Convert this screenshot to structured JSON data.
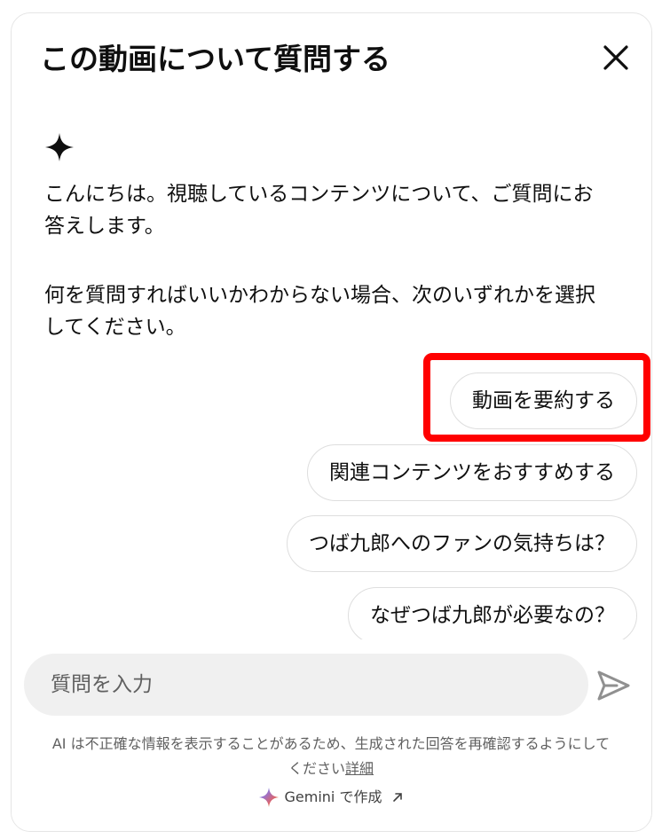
{
  "header": {
    "title": "この動画について質問する",
    "close_icon": "close-icon"
  },
  "chat": {
    "assistant_icon": "sparkle-icon",
    "messages": [
      "こんにちは。視聴しているコンテンツについて、ご質問にお答えします。",
      "何を質問すればいいかわからない場合、次のいずれかを選択してください。"
    ],
    "suggestions": [
      "動画を要約する",
      "関連コンテンツをおすすめする",
      "つば九郎へのファンの気持ちは？",
      "なぜつば九郎が必要なの？"
    ],
    "highlight_color": "#ff0000"
  },
  "input": {
    "placeholder": "質問を入力",
    "value": "",
    "send_icon": "send-icon"
  },
  "footer": {
    "disclaimer": "AI は不正確な情報を表示することがあるため、生成された回答を再確認するようにしてください",
    "details_link": "詳細",
    "gemini_label": "Gemini で作成",
    "gemini_icon": "gemini-icon",
    "external_icon": "external-link-icon"
  }
}
